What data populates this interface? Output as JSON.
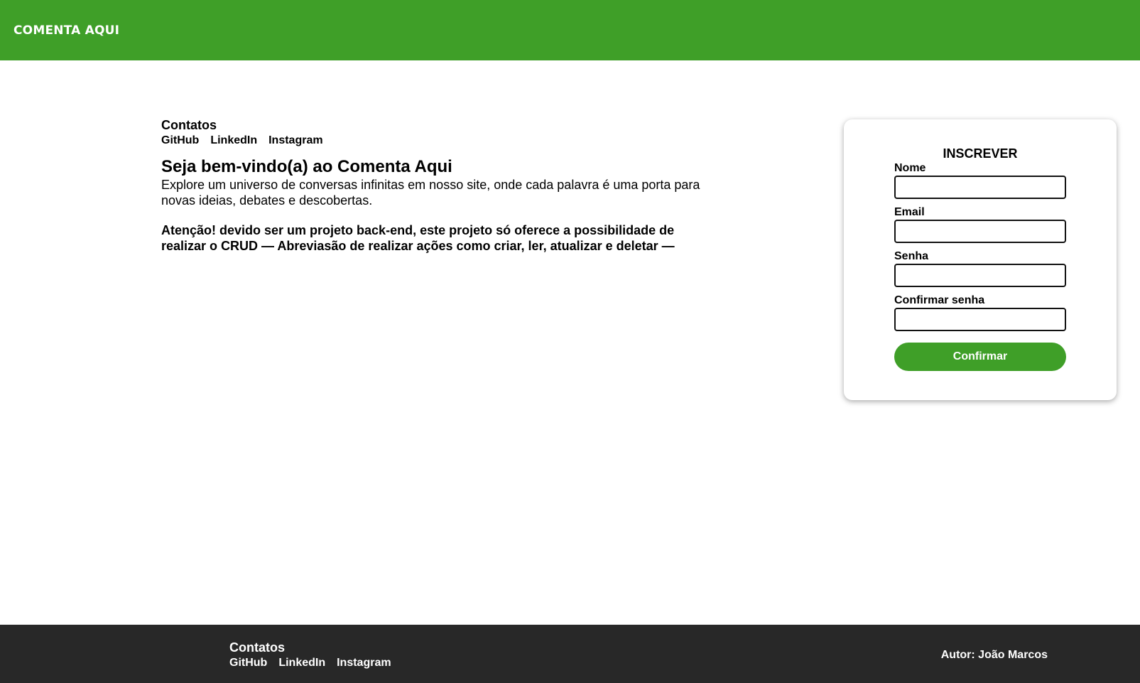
{
  "header": {
    "brand": "COMENTA AQUI"
  },
  "main": {
    "contacts_title": "Contatos",
    "contacts_links": [
      "GitHub",
      "LinkedIn",
      "Instagram"
    ],
    "welcome_title": "Seja bem-vindo(a) ao Comenta Aqui",
    "welcome_text": "Explore um universo de conversas infinitas em nosso site, onde cada palavra é uma porta para novas ideias, debates e descobertas.",
    "warning": "Atenção! devido ser um projeto back-end, este projeto só oferece a possibilidade de realizar o CRUD — Abreviasão de realizar ações como criar, ler, atualizar e deletar —"
  },
  "signup": {
    "title": "INSCREVER",
    "name_label": "Nome",
    "name_value": "",
    "email_label": "Email",
    "email_value": "",
    "password_label": "Senha",
    "password_value": "",
    "confirm_password_label": "Confirmar senha",
    "confirm_password_value": "",
    "submit_label": "Confirmar"
  },
  "footer": {
    "contacts_title": "Contatos",
    "contacts_links": [
      "GitHub",
      "LinkedIn",
      "Instagram"
    ],
    "author": "Autor: João Marcos"
  },
  "colors": {
    "brand_green": "#3f9f28",
    "footer_bg": "#282828",
    "text": "#000000"
  }
}
